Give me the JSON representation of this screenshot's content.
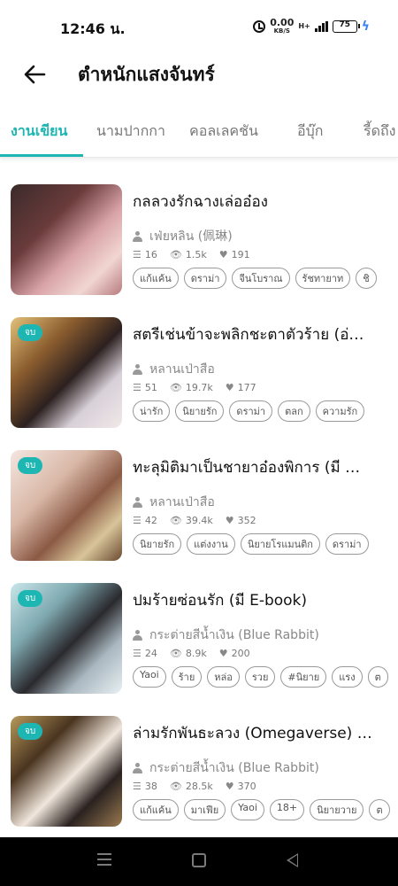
{
  "status_bar": {
    "time": "12:46 น.",
    "speed_value": "0.00",
    "speed_unit": "KB/S",
    "network": "H+",
    "battery": "75"
  },
  "header": {
    "title": "ตำหนักแสงจันทร์"
  },
  "tabs": [
    "งานเขียน",
    "นามปากกา",
    "คอลเลคชัน",
    "อีบุ๊ก",
    "รี้ดถึง"
  ],
  "active_tab": "งานเขียน",
  "accent_color": "#1eb6b3",
  "books": [
    {
      "title": "กลลวงรักฉางเล่ออ๋อง",
      "author": "เฟ่ยหลิน (佩琳)",
      "chapters": "16",
      "views": "1.5k",
      "likes": "191",
      "tags": [
        "แก้แค้น",
        "ดราม่า",
        "จีนโบราณ",
        "รัชทายาท",
        "ชิ"
      ],
      "badge": ""
    },
    {
      "title": "สตรีเช่นข้าจะพลิกชะตาตัวร้าย (อ่…",
      "author": "หลานเป่าสือ",
      "chapters": "51",
      "views": "19.7k",
      "likes": "177",
      "tags": [
        "น่ารัก",
        "นิยายรัก",
        "ดราม่า",
        "ตลก",
        "ความรัก"
      ],
      "badge": "จบ"
    },
    {
      "title": "ทะลุมิติมาเป็นชายาอ๋องพิการ (มี …",
      "author": "หลานเป่าสือ",
      "chapters": "42",
      "views": "39.4k",
      "likes": "352",
      "tags": [
        "นิยายรัก",
        "แต่งงาน",
        "นิยายโรแมนติก",
        "ดราม่า"
      ],
      "badge": "จบ"
    },
    {
      "title": "ปมร้ายซ่อนรัก (มี E-book)",
      "author": "กระต่ายสีน้ำเงิน (Blue Rabbit)",
      "chapters": "24",
      "views": "8.9k",
      "likes": "200",
      "tags": [
        "Yaoi",
        "ร้าย",
        "หล่อ",
        "รวย",
        "#นิยาย",
        "แรง",
        "ต"
      ],
      "badge": "จบ"
    },
    {
      "title": "ล่ามรักพันธะลวง (Omegaverse) …",
      "author": "กระต่ายสีน้ำเงิน (Blue Rabbit)",
      "chapters": "38",
      "views": "28.5k",
      "likes": "370",
      "tags": [
        "แก้แค้น",
        "มาเฟีย",
        "Yaoi",
        "18+",
        "นิยายวาย",
        "ต"
      ],
      "badge": "จบ"
    }
  ]
}
